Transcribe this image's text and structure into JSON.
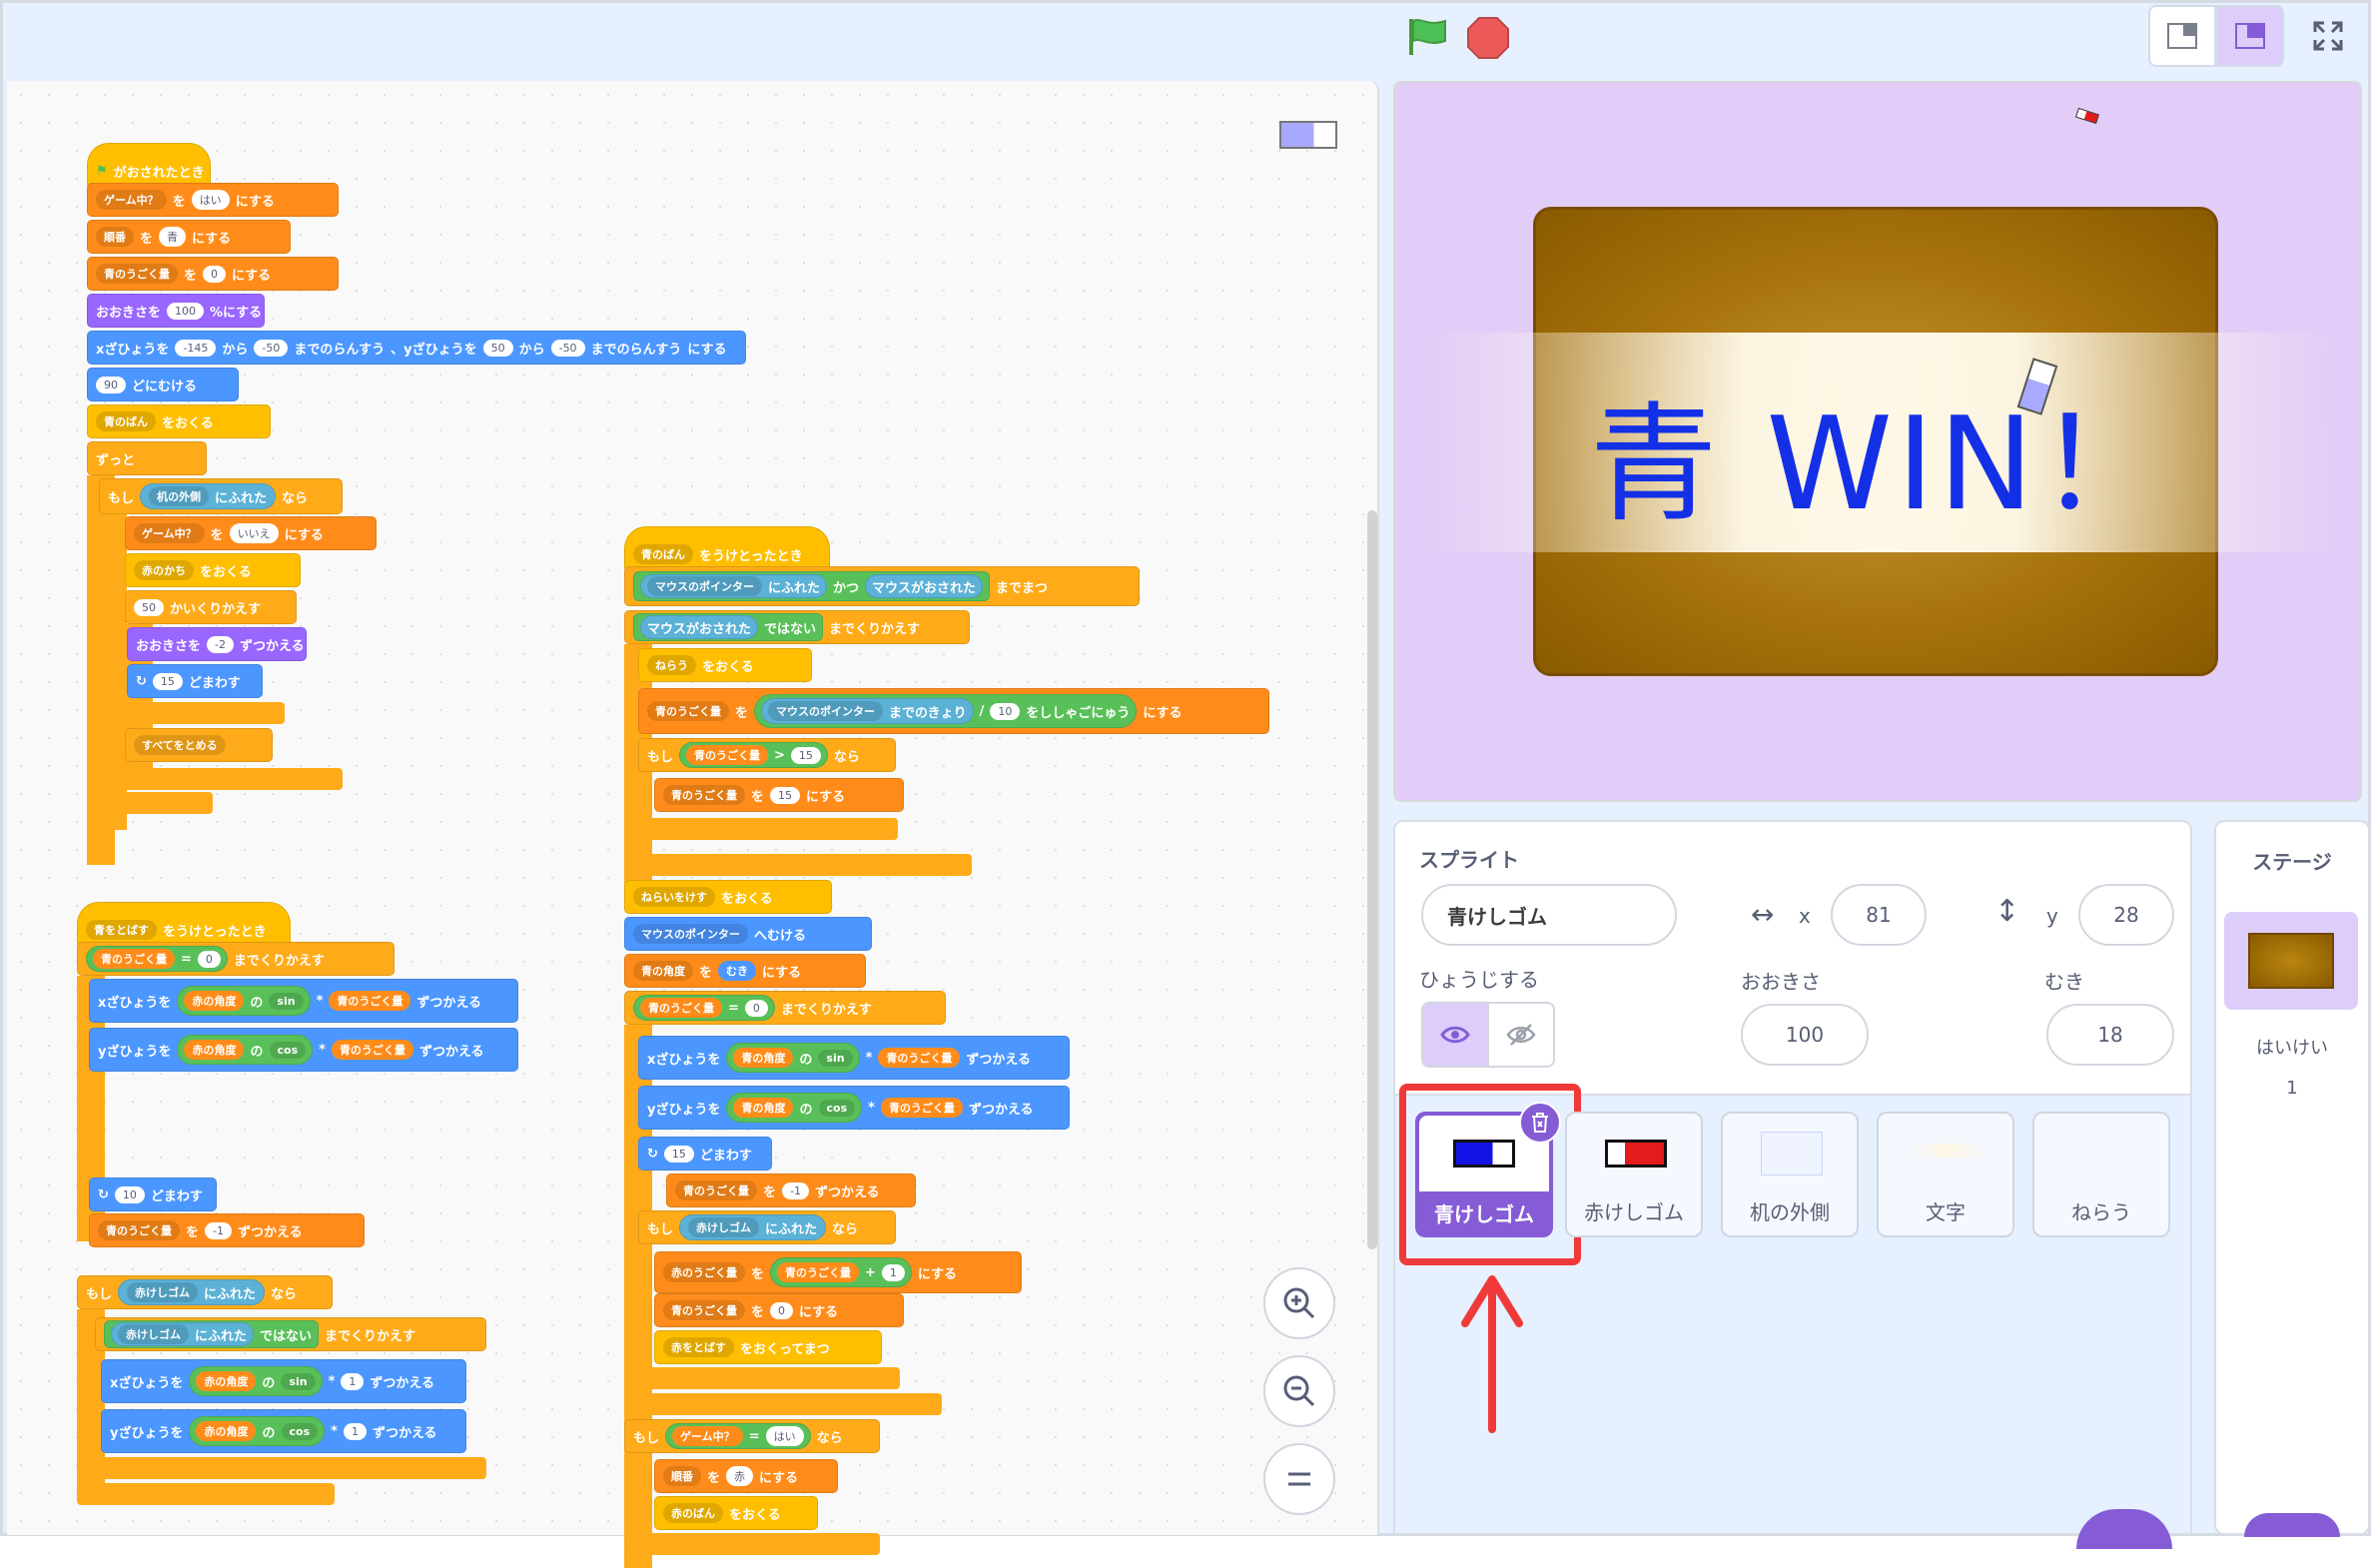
{
  "code_blocks": {
    "s1": {
      "hat": "がおされたとき",
      "b1": {
        "var": "ゲーム中？",
        "mid": "を",
        "val": "はい",
        "end": "にする"
      },
      "b2": {
        "var": "順番",
        "mid": "を",
        "val": "青",
        "end": "にする"
      },
      "b3": {
        "var": "青のうごく量",
        "mid": "を",
        "val": "0",
        "end": "にする"
      },
      "b4": {
        "a": "おおきさを",
        "val": "100",
        "b": "%にする"
      },
      "b5": {
        "a": "xざひょうを",
        "v1": "-145",
        "b": "から",
        "v2": "-50",
        "c": "までのらんすう",
        "d": "、yざひょうを",
        "v3": "50",
        "e": "から",
        "v4": "-50",
        "f": "までのらんすう",
        "g": "にする"
      },
      "b6": {
        "val": "90",
        "a": "どにむける"
      },
      "b7": {
        "var": "青のばん",
        "a": "をおくる"
      },
      "forever": "ずっと",
      "if": "もし",
      "if_cond": {
        "var": "机の外側",
        "a": "にふれた"
      },
      "then": "なら",
      "c1": {
        "var": "ゲーム中？",
        "mid": "を",
        "val": "いいえ",
        "end": "にする"
      },
      "c2": {
        "var": "赤のかち",
        "a": "をおくる"
      },
      "c3": {
        "val": "50",
        "a": "かいくりかえす"
      },
      "c4": {
        "a": "おおきさを",
        "val": "-2",
        "b": "ずつかえる"
      },
      "c5": {
        "val": "15",
        "a": "どまわす"
      },
      "stop": "すべてをとめる"
    },
    "s2": {
      "hat": {
        "var": "青をとばす",
        "a": "をうけとったとき"
      },
      "r1": {
        "var": "青のうごく量",
        "eq": "=",
        "val": "0",
        "a": "までくりかえす"
      },
      "r2": {
        "a": "xざひょうを",
        "b": "赤の角度",
        "c": "の",
        "fn": "sin",
        "d": "*",
        "e": "青のうごく量",
        "f": "ずつかえる"
      },
      "r3": {
        "a": "yざひょうを",
        "b": "赤の角度",
        "c": "の",
        "fn": "cos",
        "d": "*",
        "e": "青のうごく量",
        "f": "ずつかえる"
      },
      "r4": {
        "val": "10",
        "a": "どまわす"
      },
      "r5": {
        "var": "青のうごく量",
        "mid": "を",
        "val": "-1",
        "a": "ずつかえる"
      },
      "i1": {
        "a": "もし",
        "var": "赤けしゴム",
        "b": "にふれた",
        "c": "なら"
      },
      "i2": {
        "var": "赤けしゴム",
        "b": "にふれた",
        "c": "ではない",
        "d": "までくりかえす"
      },
      "i3": {
        "a": "xざひょうを",
        "b": "赤の角度",
        "c": "の",
        "fn": "sin",
        "d": "*",
        "val": "1",
        "e": "ずつかえる"
      },
      "i4": {
        "a": "yざひょうを",
        "b": "赤の角度",
        "c": "の",
        "fn": "cos",
        "d": "*",
        "val": "1",
        "e": "ずつかえる"
      }
    },
    "s3": {
      "hat": {
        "var": "青のばん",
        "a": "をうけとったとき"
      },
      "w1": {
        "a": "マウスのポインター",
        "b": "にふれた",
        "c": "かつ",
        "d": "マウスがおされた",
        "e": "までまつ"
      },
      "w2": {
        "a": "マウスがおされた",
        "b": "ではない",
        "c": "までくりかえす"
      },
      "w3": {
        "var": "ねらう",
        "a": "をおくる"
      },
      "w4": {
        "var": "青のうごく量",
        "mid": "を",
        "a": "マウスのポインター",
        "b": "までのきょり",
        "c": "/",
        "val": "10",
        "d": "をししゃごにゅう",
        "e": "にする"
      },
      "w5": {
        "a": "もし",
        "var": "青のうごく量",
        "op": ">",
        "val": "15",
        "b": "なら"
      },
      "w6": {
        "var": "青のうごく量",
        "mid": "を",
        "val": "15",
        "a": "にする"
      },
      "w7": {
        "var": "ねらいをけす",
        "a": "をおくる"
      },
      "w8": {
        "var": "マウスのポインター",
        "a": "へむける"
      },
      "w9": {
        "var": "青の角度",
        "mid": "を",
        "val": "むき",
        "a": "にする"
      },
      "w10": {
        "var": "青のうごく量",
        "eq": "=",
        "val": "0",
        "a": "までくりかえす"
      },
      "w11": {
        "a": "xざひょうを",
        "b": "青の角度",
        "c": "の",
        "fn": "sin",
        "d": "*",
        "e": "青のうごく量",
        "f": "ずつかえる"
      },
      "w12": {
        "a": "yざひょうを",
        "b": "青の角度",
        "c": "の",
        "fn": "cos",
        "d": "*",
        "e": "青のうごく量",
        "f": "ずつかえる"
      },
      "w13": {
        "val": "15",
        "a": "どまわす"
      },
      "w14": {
        "var": "青のうごく量",
        "mid": "を",
        "val": "-1",
        "a": "ずつかえる"
      },
      "w15": {
        "a": "もし",
        "var": "赤けしゴム",
        "b": "にふれた",
        "c": "なら"
      },
      "w16": {
        "var": "赤のうごく量",
        "mid": "を",
        "e": "青のうごく量",
        "plus": "+",
        "val": "1",
        "a": "にする"
      },
      "w17": {
        "var": "青のうごく量",
        "mid": "を",
        "val": "0",
        "a": "にする"
      },
      "w18": {
        "var": "赤をとばす",
        "a": "をおくってまつ"
      },
      "w19": {
        "a": "もし",
        "var": "ゲーム中？",
        "eq": "=",
        "val": "はい",
        "b": "なら"
      },
      "w20": {
        "var": "順番",
        "mid": "を",
        "val": "赤",
        "a": "にする"
      },
      "w21": {
        "var": "赤のばん",
        "a": "をおくる"
      }
    }
  },
  "stage": {
    "win_text": "青 WIN！"
  },
  "sprite_info": {
    "label_sprite": "スプライト",
    "sprite_name": "青けしゴム",
    "x_label": "x",
    "x_value": "81",
    "y_label": "y",
    "y_value": "28",
    "show_label": "ひょうじする",
    "size_label": "おおきさ",
    "size_value": "100",
    "direction_label": "むき",
    "direction_value": "18"
  },
  "sprite_list": [
    {
      "name": "青けしゴム",
      "selected": true
    },
    {
      "name": "赤けしゴム",
      "selected": false
    },
    {
      "name": "机の外側",
      "selected": false
    },
    {
      "name": "文字",
      "selected": false
    },
    {
      "name": "ねらう",
      "selected": false
    }
  ],
  "stage_panel": {
    "title": "ステージ",
    "backdrops_label": "はいけい",
    "backdrops_count": "1"
  },
  "colors": {
    "accent": "#855cd6",
    "highlight": "#f03a3a",
    "win_blue": "#1430e6"
  }
}
